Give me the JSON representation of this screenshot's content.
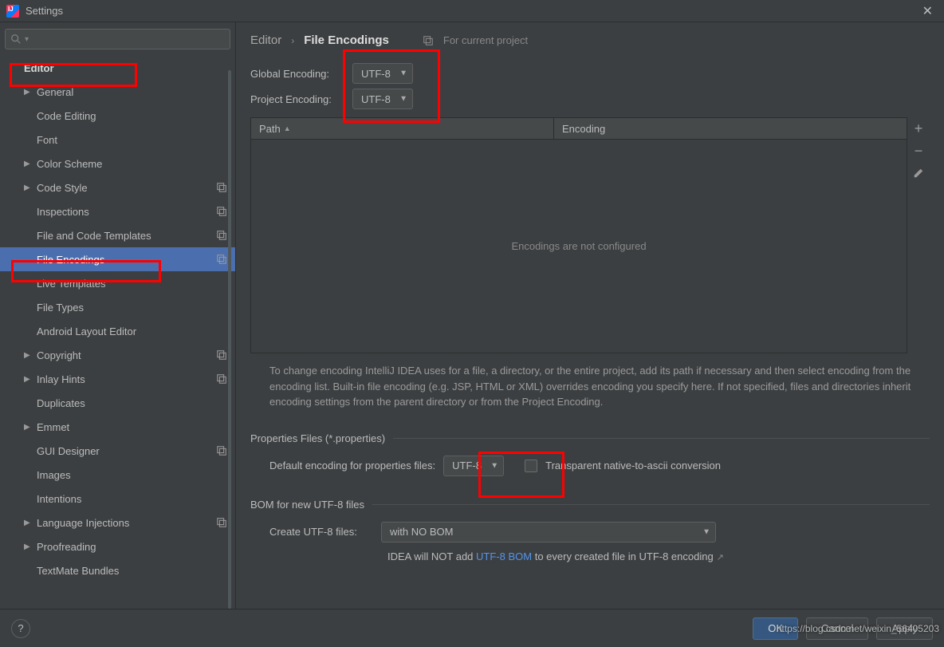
{
  "window": {
    "title": "Settings"
  },
  "breadcrumb": {
    "root": "Editor",
    "current": "File Encodings",
    "project_note": "For current project"
  },
  "sidebar": {
    "search_placeholder": "",
    "items": [
      {
        "label": "Editor",
        "group": true
      },
      {
        "label": "General",
        "arrow": true
      },
      {
        "label": "Code Editing"
      },
      {
        "label": "Font"
      },
      {
        "label": "Color Scheme",
        "arrow": true
      },
      {
        "label": "Code Style",
        "arrow": true,
        "ribbon": true
      },
      {
        "label": "Inspections",
        "ribbon": true
      },
      {
        "label": "File and Code Templates",
        "ribbon": true
      },
      {
        "label": "File Encodings",
        "selected": true,
        "ribbon": true
      },
      {
        "label": "Live Templates"
      },
      {
        "label": "File Types"
      },
      {
        "label": "Android Layout Editor"
      },
      {
        "label": "Copyright",
        "arrow": true,
        "ribbon": true
      },
      {
        "label": "Inlay Hints",
        "arrow": true,
        "ribbon": true
      },
      {
        "label": "Duplicates"
      },
      {
        "label": "Emmet",
        "arrow": true
      },
      {
        "label": "GUI Designer",
        "ribbon": true
      },
      {
        "label": "Images"
      },
      {
        "label": "Intentions"
      },
      {
        "label": "Language Injections",
        "arrow": true,
        "ribbon": true
      },
      {
        "label": "Proofreading",
        "arrow": true
      },
      {
        "label": "TextMate Bundles"
      }
    ]
  },
  "encodings": {
    "global_label": "Global Encoding:",
    "global_value": "UTF-8",
    "project_label": "Project Encoding:",
    "project_value": "UTF-8",
    "table": {
      "col_path": "Path",
      "col_encoding": "Encoding",
      "empty": "Encodings are not configured"
    },
    "help": "To change encoding IntelliJ IDEA uses for a file, a directory, or the entire project, add its path if necessary and then select encoding from the encoding list. Built-in file encoding (e.g. JSP, HTML or XML) overrides encoding you specify here. If not specified, files and directories inherit encoding settings from the parent directory or from the Project Encoding."
  },
  "properties": {
    "section": "Properties Files (*.properties)",
    "default_label": "Default encoding for properties files:",
    "default_value": "UTF-8",
    "transparent": "Transparent native-to-ascii conversion"
  },
  "bom": {
    "section": "BOM for new UTF-8 files",
    "create_label": "Create UTF-8 files:",
    "create_value": "with NO BOM",
    "note_pre": "IDEA will NOT add ",
    "note_link": "UTF-8 BOM",
    "note_post": " to every created file in UTF-8 encoding"
  },
  "buttons": {
    "ok": "OK",
    "cancel": "Cancel",
    "apply": "Apply"
  },
  "watermark": "https://blog.csdn.net/weixin_56405203"
}
